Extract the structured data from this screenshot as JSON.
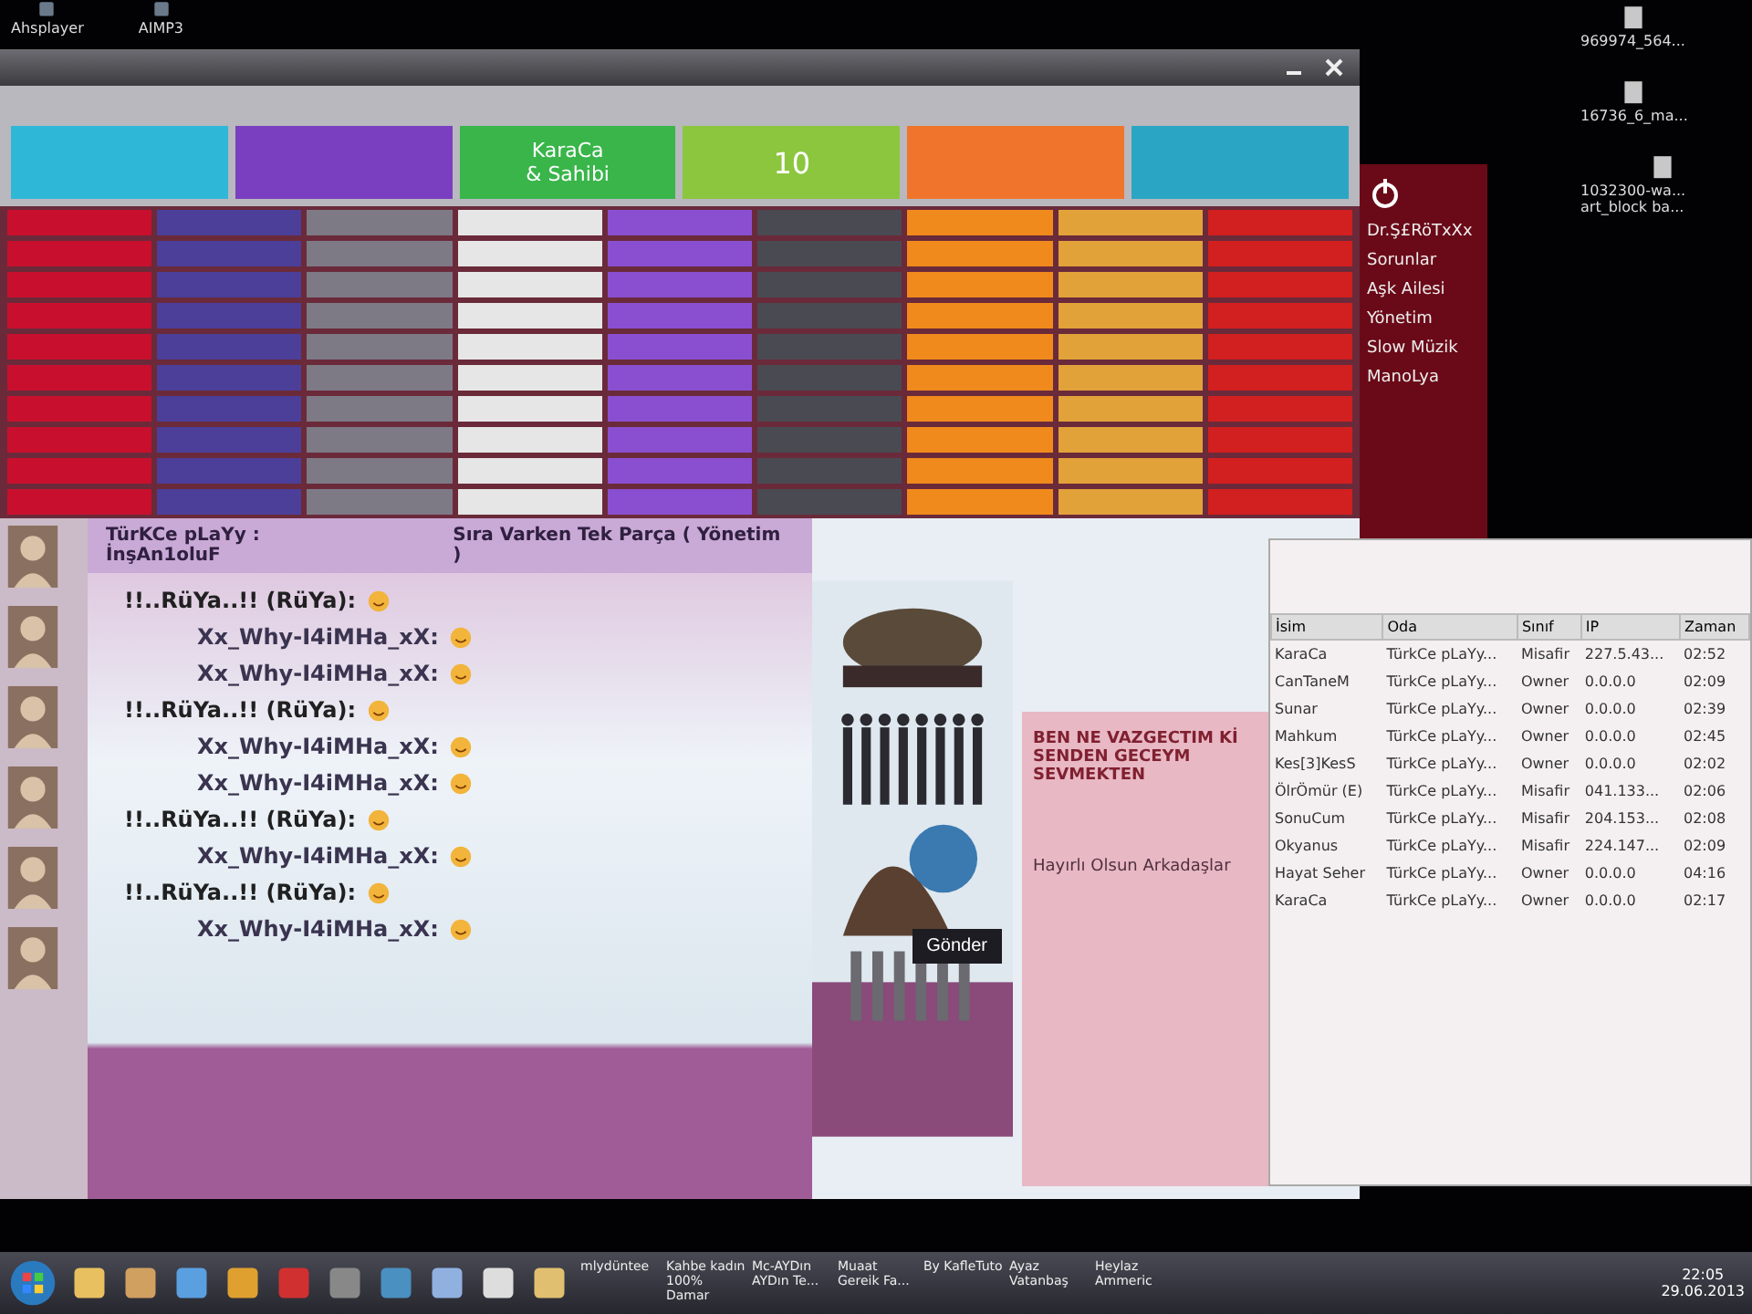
{
  "desktop_icons": [
    {
      "label": "Ahsplayer"
    },
    {
      "label": "AIMP3"
    }
  ],
  "desktop_files": [
    {
      "label": "969974_564..."
    },
    {
      "label": "16736_6_ma..."
    },
    {
      "label": "1032300-wa... art_block ba..."
    }
  ],
  "chat_window": {
    "header_tiles": [
      {
        "color": "#2fb7d8"
      },
      {
        "color": "#7a3fc0"
      },
      {
        "color": "#39b54a",
        "title": "KaraCa",
        "subtitle": "& Sahibi"
      },
      {
        "color": "#8cc63f",
        "count": "10"
      },
      {
        "color": "#f0742c"
      },
      {
        "color": "#2aa6c4"
      }
    ],
    "tile_columns": [
      {
        "color": "#c8102e"
      },
      {
        "color": "#4b3f9a"
      },
      {
        "color": "#7d7a86"
      },
      {
        "color": "#e6e6e6"
      },
      {
        "color": "#8a4fd0"
      },
      {
        "color": "#4a4a52"
      },
      {
        "color": "#f08a1c"
      },
      {
        "color": "#e2a23a"
      },
      {
        "color": "#d21f1f"
      }
    ],
    "room_header": {
      "title": "TürKCe pLaYy : İnşAn1oluF",
      "now_playing": "Sıra Varken Tek Parça ( Yönetim )"
    },
    "messages": [
      {
        "author": "!!..RüYa..!! (RüYa):",
        "kind": "her"
      },
      {
        "author": "Xx_Why-I4iMHa_xX:",
        "kind": "him"
      },
      {
        "author": "Xx_Why-I4iMHa_xX:",
        "kind": "him"
      },
      {
        "author": "!!..RüYa..!! (RüYa):",
        "kind": "her"
      },
      {
        "author": "Xx_Why-I4iMHa_xX:",
        "kind": "him"
      },
      {
        "author": "Xx_Why-I4iMHa_xX:",
        "kind": "him"
      },
      {
        "author": "!!..RüYa..!! (RüYa):",
        "kind": "her"
      },
      {
        "author": "Xx_Why-I4iMHa_xX:",
        "kind": "him"
      },
      {
        "author": "!!..RüYa..!! (RüYa):",
        "kind": "her"
      },
      {
        "author": "Xx_Why-I4iMHa_xX:",
        "kind": "him"
      }
    ],
    "send_button": "Gönder"
  },
  "room_list": [
    {
      "label": "Dr.Ş£RöTxXx"
    },
    {
      "label": "Sorunlar"
    },
    {
      "label": "Aşk Ailesi"
    },
    {
      "label": "Yönetim"
    },
    {
      "label": "Slow Müzik"
    },
    {
      "label": "ManoLya"
    }
  ],
  "message_panel": {
    "text": "BEN NE VAZGECTIM Kİ SENDEN GECEYM SEVMEKTEN",
    "greeting": "Hayırlı Olsun Arkadaşlar"
  },
  "user_table": {
    "columns": [
      "İsim",
      "Oda",
      "Sınıf",
      "IP",
      "Zaman"
    ],
    "rows": [
      [
        "KaraCa",
        "TürkCe pLaYy...",
        "Misafir",
        "227.5.43...",
        "02:52"
      ],
      [
        "CanTaneM",
        "TürkCe pLaYy...",
        "Owner",
        "0.0.0.0",
        "02:09"
      ],
      [
        "Sunar",
        "TürkCe pLaYy...",
        "Owner",
        "0.0.0.0",
        "02:39"
      ],
      [
        "Mahkum",
        "TürkCe pLaYy...",
        "Owner",
        "0.0.0.0",
        "02:45"
      ],
      [
        "Kes[3]KesS",
        "TürkCe pLaYy...",
        "Owner",
        "0.0.0.0",
        "02:02"
      ],
      [
        "ÖlrÖmür (E)",
        "TürkCe pLaYy...",
        "Misafir",
        "041.133...",
        "02:06"
      ],
      [
        "SonuCum",
        "TürkCe pLaYy...",
        "Misafir",
        "204.153...",
        "02:08"
      ],
      [
        "Okyanus",
        "TürkCe pLaYy...",
        "Misafir",
        "224.147...",
        "02:09"
      ],
      [
        "Hayat Seher",
        "TürkCe pLaYy...",
        "Owner",
        "0.0.0.0",
        "04:16"
      ],
      [
        "KaraCa",
        "TürkCe pLaYy...",
        "Owner",
        "0.0.0.0",
        "02:17"
      ]
    ]
  },
  "taskbar": {
    "items": [
      {
        "label": "mlydüntee"
      },
      {
        "label": "Kahbe kadın 100% Damar"
      },
      {
        "label": "Mc-AYDın AYDın Te..."
      },
      {
        "label": "Muaat Gereik Fa..."
      },
      {
        "label": "By KafleTuto"
      },
      {
        "label": "Ayaz Vatanbaş"
      },
      {
        "label": "Heylaz Ammeric"
      }
    ],
    "clock": "22:05",
    "date": "29.06.2013"
  }
}
